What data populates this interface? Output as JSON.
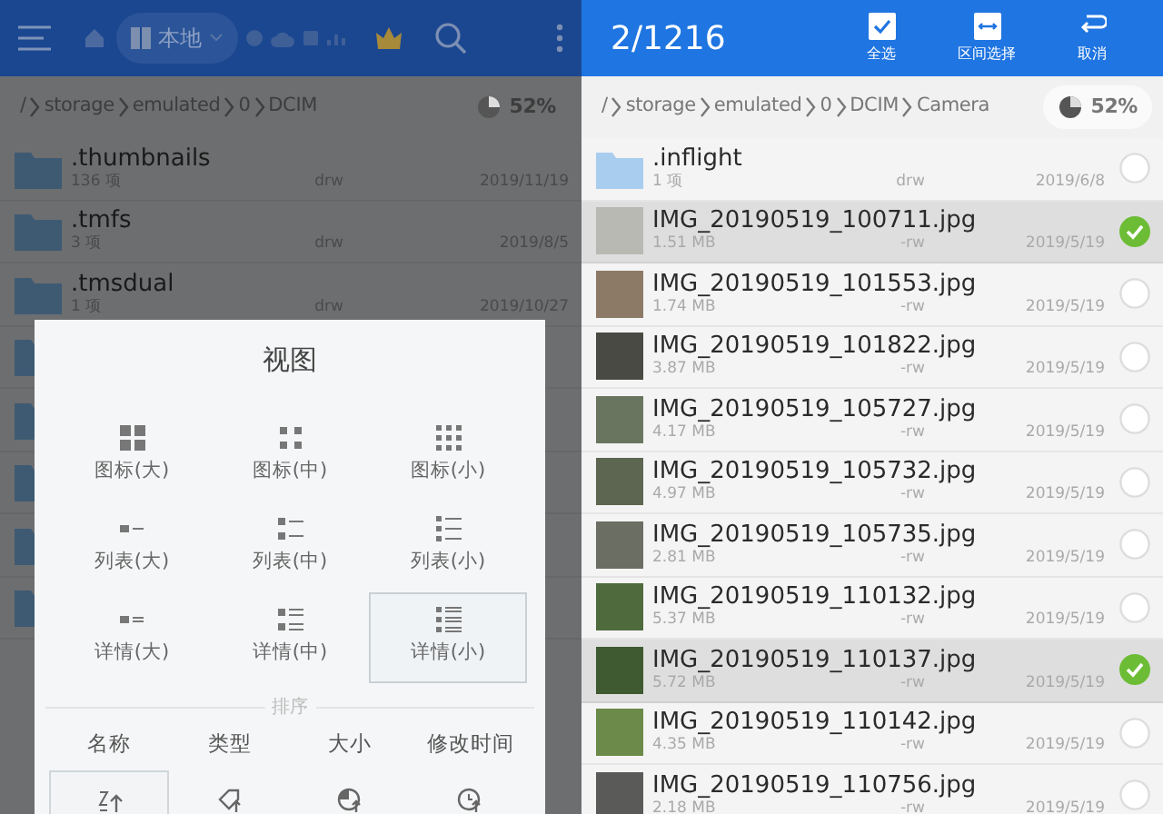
{
  "left_screen": {
    "toolbar": {
      "location": "本地"
    },
    "breadcrumb": [
      "/",
      "storage",
      "emulated",
      "0",
      "DCIM"
    ],
    "storage": {
      "reading": "52%"
    },
    "files": [
      {
        "name": ".thumbnails",
        "info": "136 项",
        "perms": "drw",
        "date": "2019/11/19"
      },
      {
        "name": ".tmfs",
        "info": "3 项",
        "perms": "drw",
        "date": "2019/8/5"
      },
      {
        "name": ".tmsdual",
        "info": "1 项",
        "perms": "drw",
        "date": "2019/10/27"
      }
    ],
    "view_dialog": {
      "title": "视图",
      "view_options": [
        {
          "label": "图标(大)",
          "selected": false
        },
        {
          "label": "图标(中)",
          "selected": false
        },
        {
          "label": "图标(小)",
          "selected": false
        },
        {
          "label": "列表(大)",
          "selected": false
        },
        {
          "label": "列表(中)",
          "selected": false
        },
        {
          "label": "列表(小)",
          "selected": false
        },
        {
          "label": "详情(大)",
          "selected": false
        },
        {
          "label": "详情(中)",
          "selected": false
        },
        {
          "label": "详情(小)",
          "selected": true
        }
      ],
      "sort_heading": "排序",
      "sort_options": [
        {
          "label": "名称",
          "selected": true
        },
        {
          "label": "类型",
          "selected": false
        },
        {
          "label": "大小",
          "selected": false
        },
        {
          "label": "修改时间",
          "selected": false
        }
      ]
    }
  },
  "right_screen": {
    "selection_count": "2/1216",
    "actions": [
      {
        "label": "全选"
      },
      {
        "label": "区间选择"
      },
      {
        "label": "取消"
      }
    ],
    "breadcrumb": [
      "/",
      "storage",
      "emulated",
      "0",
      "DCIM",
      "Camera"
    ],
    "storage": {
      "reading": "52%"
    },
    "files": [
      {
        "kind": "folder",
        "name": ".inflight",
        "info": "1 项",
        "perms": "drw",
        "date": "2019/6/8",
        "selected": false
      },
      {
        "kind": "image",
        "name": "IMG_20190519_100711.jpg",
        "info": "1.51 MB",
        "perms": "-rw",
        "date": "2019/5/19",
        "selected": true
      },
      {
        "kind": "image",
        "name": "IMG_20190519_101553.jpg",
        "info": "1.74 MB",
        "perms": "-rw",
        "date": "2019/5/19",
        "selected": false
      },
      {
        "kind": "image",
        "name": "IMG_20190519_101822.jpg",
        "info": "3.87 MB",
        "perms": "-rw",
        "date": "2019/5/19",
        "selected": false
      },
      {
        "kind": "image",
        "name": "IMG_20190519_105727.jpg",
        "info": "4.17 MB",
        "perms": "-rw",
        "date": "2019/5/19",
        "selected": false
      },
      {
        "kind": "image",
        "name": "IMG_20190519_105732.jpg",
        "info": "4.97 MB",
        "perms": "-rw",
        "date": "2019/5/19",
        "selected": false
      },
      {
        "kind": "image",
        "name": "IMG_20190519_105735.jpg",
        "info": "2.81 MB",
        "perms": "-rw",
        "date": "2019/5/19",
        "selected": false
      },
      {
        "kind": "image",
        "name": "IMG_20190519_110132.jpg",
        "info": "5.37 MB",
        "perms": "-rw",
        "date": "2019/5/19",
        "selected": false
      },
      {
        "kind": "image",
        "name": "IMG_20190519_110137.jpg",
        "info": "5.72 MB",
        "perms": "-rw",
        "date": "2019/5/19",
        "selected": true
      },
      {
        "kind": "image",
        "name": "IMG_20190519_110142.jpg",
        "info": "4.35 MB",
        "perms": "-rw",
        "date": "2019/5/19",
        "selected": false
      },
      {
        "kind": "image",
        "name": "IMG_20190519_110756.jpg",
        "info": "2.18 MB",
        "perms": "-rw",
        "date": "2019/5/19",
        "selected": false
      }
    ]
  }
}
